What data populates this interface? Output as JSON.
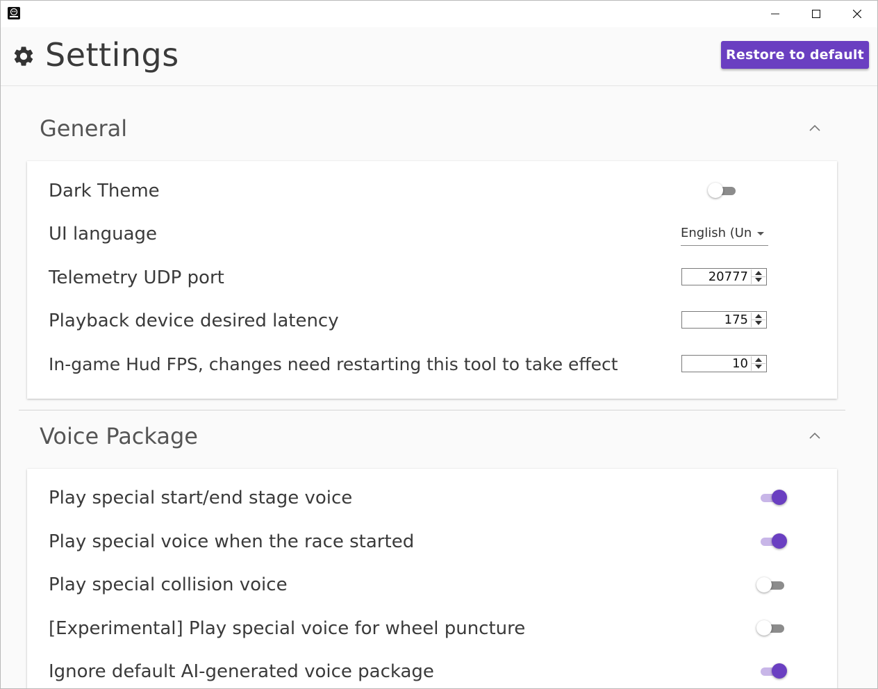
{
  "window": {
    "controls": {
      "minimize_icon": "minimize-icon",
      "maximize_icon": "maximize-icon",
      "close_icon": "close-icon"
    }
  },
  "header": {
    "title": "Settings",
    "restore_button": "Restore to default",
    "accent_color": "#6a3fc1"
  },
  "general": {
    "title": "General",
    "rows": {
      "dark_theme": {
        "label": "Dark Theme",
        "enabled": false
      },
      "ui_language": {
        "label": "UI language",
        "value": "English (Uni"
      },
      "udp_port": {
        "label": "Telemetry UDP port",
        "value": "20777"
      },
      "latency": {
        "label": "Playback device desired latency",
        "value": "175"
      },
      "hud_fps": {
        "label": "In-game Hud FPS, changes need restarting this tool to take effect",
        "value": "10"
      }
    }
  },
  "voice": {
    "title": "Voice Package",
    "rows": {
      "start_end": {
        "label": "Play special start/end stage voice",
        "enabled": true
      },
      "race_started": {
        "label": "Play special voice when the race started",
        "enabled": true
      },
      "collision": {
        "label": "Play special collision voice",
        "enabled": false
      },
      "puncture": {
        "label": "[Experimental] Play special voice for wheel puncture",
        "enabled": false
      },
      "ignore_ai": {
        "label": "Ignore default AI-generated voice package",
        "enabled": true
      }
    }
  }
}
